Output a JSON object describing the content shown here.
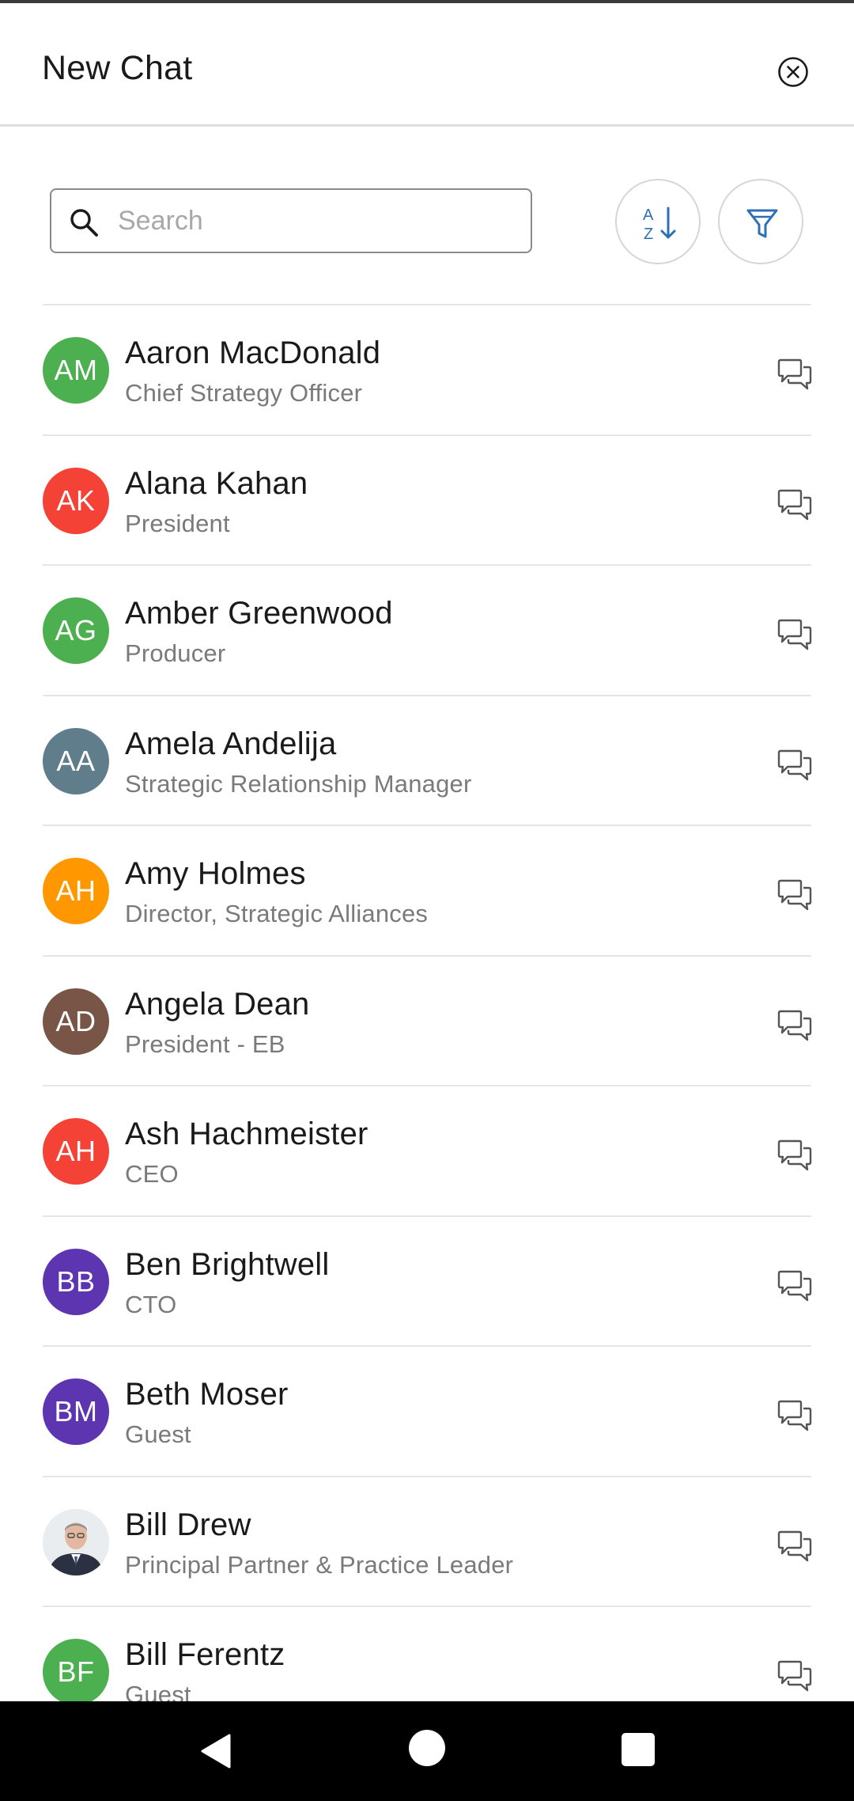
{
  "header": {
    "title": "New Chat",
    "close_icon": "close-circle-icon"
  },
  "search": {
    "placeholder": "Search",
    "value": "",
    "icon": "search-icon"
  },
  "toolbar": {
    "sort_icon": "sort-az-icon",
    "filter_icon": "filter-icon",
    "accent_color": "#2f6fb5"
  },
  "contacts": [
    {
      "initials": "AM",
      "name": "Aaron MacDonald",
      "role": "Chief Strategy Officer",
      "color": "#4caf50"
    },
    {
      "initials": "AK",
      "name": "Alana Kahan",
      "role": "President",
      "color": "#f44336"
    },
    {
      "initials": "AG",
      "name": "Amber Greenwood",
      "role": "Producer",
      "color": "#4caf50"
    },
    {
      "initials": "AA",
      "name": "Amela Andelija",
      "role": "Strategic Relationship Manager",
      "color": "#607d8b"
    },
    {
      "initials": "AH",
      "name": "Amy Holmes",
      "role": "Director, Strategic Alliances",
      "color": "#ff9800"
    },
    {
      "initials": "AD",
      "name": "Angela Dean",
      "role": "President - EB",
      "color": "#795548"
    },
    {
      "initials": "AH",
      "name": "Ash Hachmeister",
      "role": "CEO",
      "color": "#f44336"
    },
    {
      "initials": "BB",
      "name": "Ben Brightwell",
      "role": "CTO",
      "color": "#5e35b1"
    },
    {
      "initials": "BM",
      "name": "Beth Moser",
      "role": "Guest",
      "color": "#5e35b1"
    },
    {
      "initials": "",
      "name": "Bill Drew",
      "role": "Principal Partner & Practice Leader",
      "color": "#eceff1",
      "photo": true
    },
    {
      "initials": "BF",
      "name": "Bill Ferentz",
      "role": "Guest",
      "color": "#4caf50"
    }
  ],
  "row_action_icon": "chat-bubbles-icon",
  "navigation": {
    "back_icon": "back-triangle-icon",
    "home_icon": "home-circle-icon",
    "recents_icon": "recents-square-icon"
  }
}
